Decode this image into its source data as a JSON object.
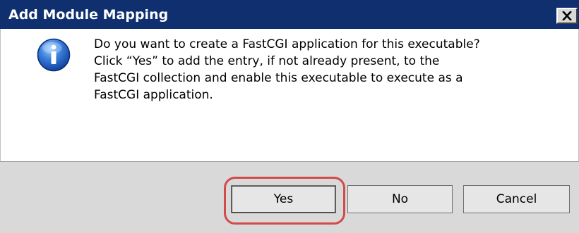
{
  "window": {
    "title": "Add Module Mapping",
    "close_icon": "close-icon",
    "title_bar_color": "#0f2f6f"
  },
  "message": {
    "icon": "info-icon",
    "lines": [
      "Do you want to create a FastCGI application for this executable?",
      "Click “Yes” to add the entry, if not already present, to the",
      "FastCGI collection and enable this executable to execute as a",
      "FastCGI application."
    ]
  },
  "buttons": {
    "yes_label": "Yes",
    "no_label": "No",
    "cancel_label": "Cancel"
  },
  "annotation": {
    "highlight_color": "#d24a4a",
    "highlighted_button": "Yes"
  }
}
